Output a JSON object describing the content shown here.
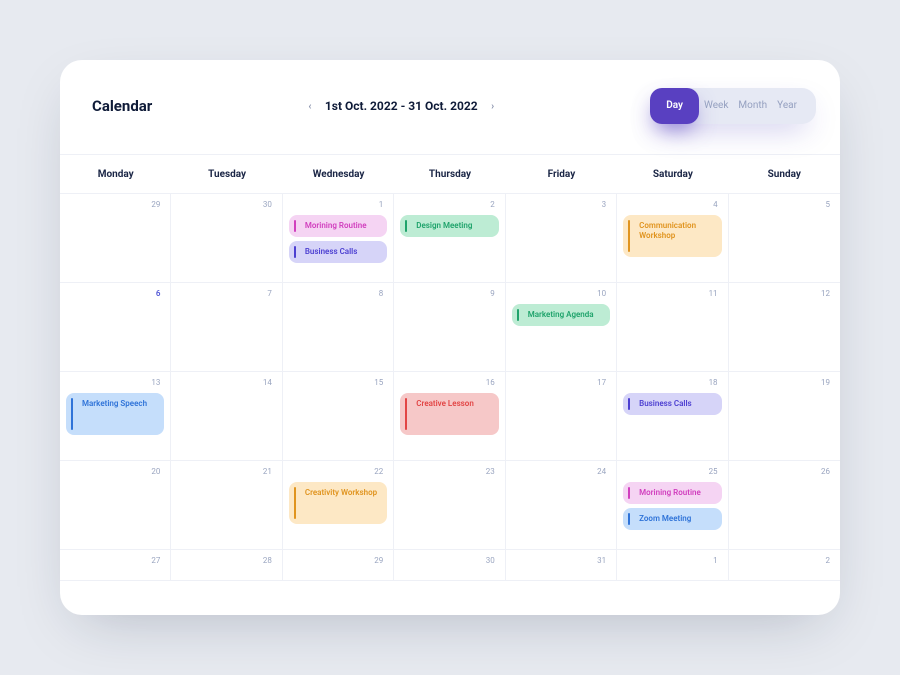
{
  "title": "Calendar",
  "range": {
    "label": "1st Oct. 2022 - 31 Oct. 2022"
  },
  "views": {
    "active": "Day",
    "opt_week": "Week",
    "opt_month": "Month",
    "opt_year": "Year"
  },
  "weekdays": [
    "Monday",
    "Tuesday",
    "Wednesday",
    "Thursday",
    "Friday",
    "Saturday",
    "Sunday"
  ],
  "cells": {
    "r1": [
      "29",
      "30",
      "1",
      "2",
      "3",
      "4",
      "5"
    ],
    "r2": [
      "6",
      "7",
      "8",
      "9",
      "10",
      "11",
      "12"
    ],
    "r3": [
      "13",
      "14",
      "15",
      "16",
      "17",
      "18",
      "19"
    ],
    "r4": [
      "20",
      "21",
      "22",
      "23",
      "24",
      "25",
      "26"
    ],
    "r5": [
      "27",
      "28",
      "29",
      "30",
      "31",
      "1",
      "2"
    ]
  },
  "events": {
    "morning_routine": "Morining Routine",
    "business_calls": "Business Calls",
    "design_meeting": "Design Meeting",
    "communication_workshop": "Communication Workshop",
    "marketing_agenda": "Marketing Agenda",
    "marketing_speech": "Marketing Speech",
    "creative_lesson": "Creative Lesson",
    "business_calls_2": "Business Calls",
    "creativity_workshop": "Creativity Workshop",
    "morning_routine_2": "Morining Routine",
    "zoom_meeting": "Zoom Meeting"
  }
}
